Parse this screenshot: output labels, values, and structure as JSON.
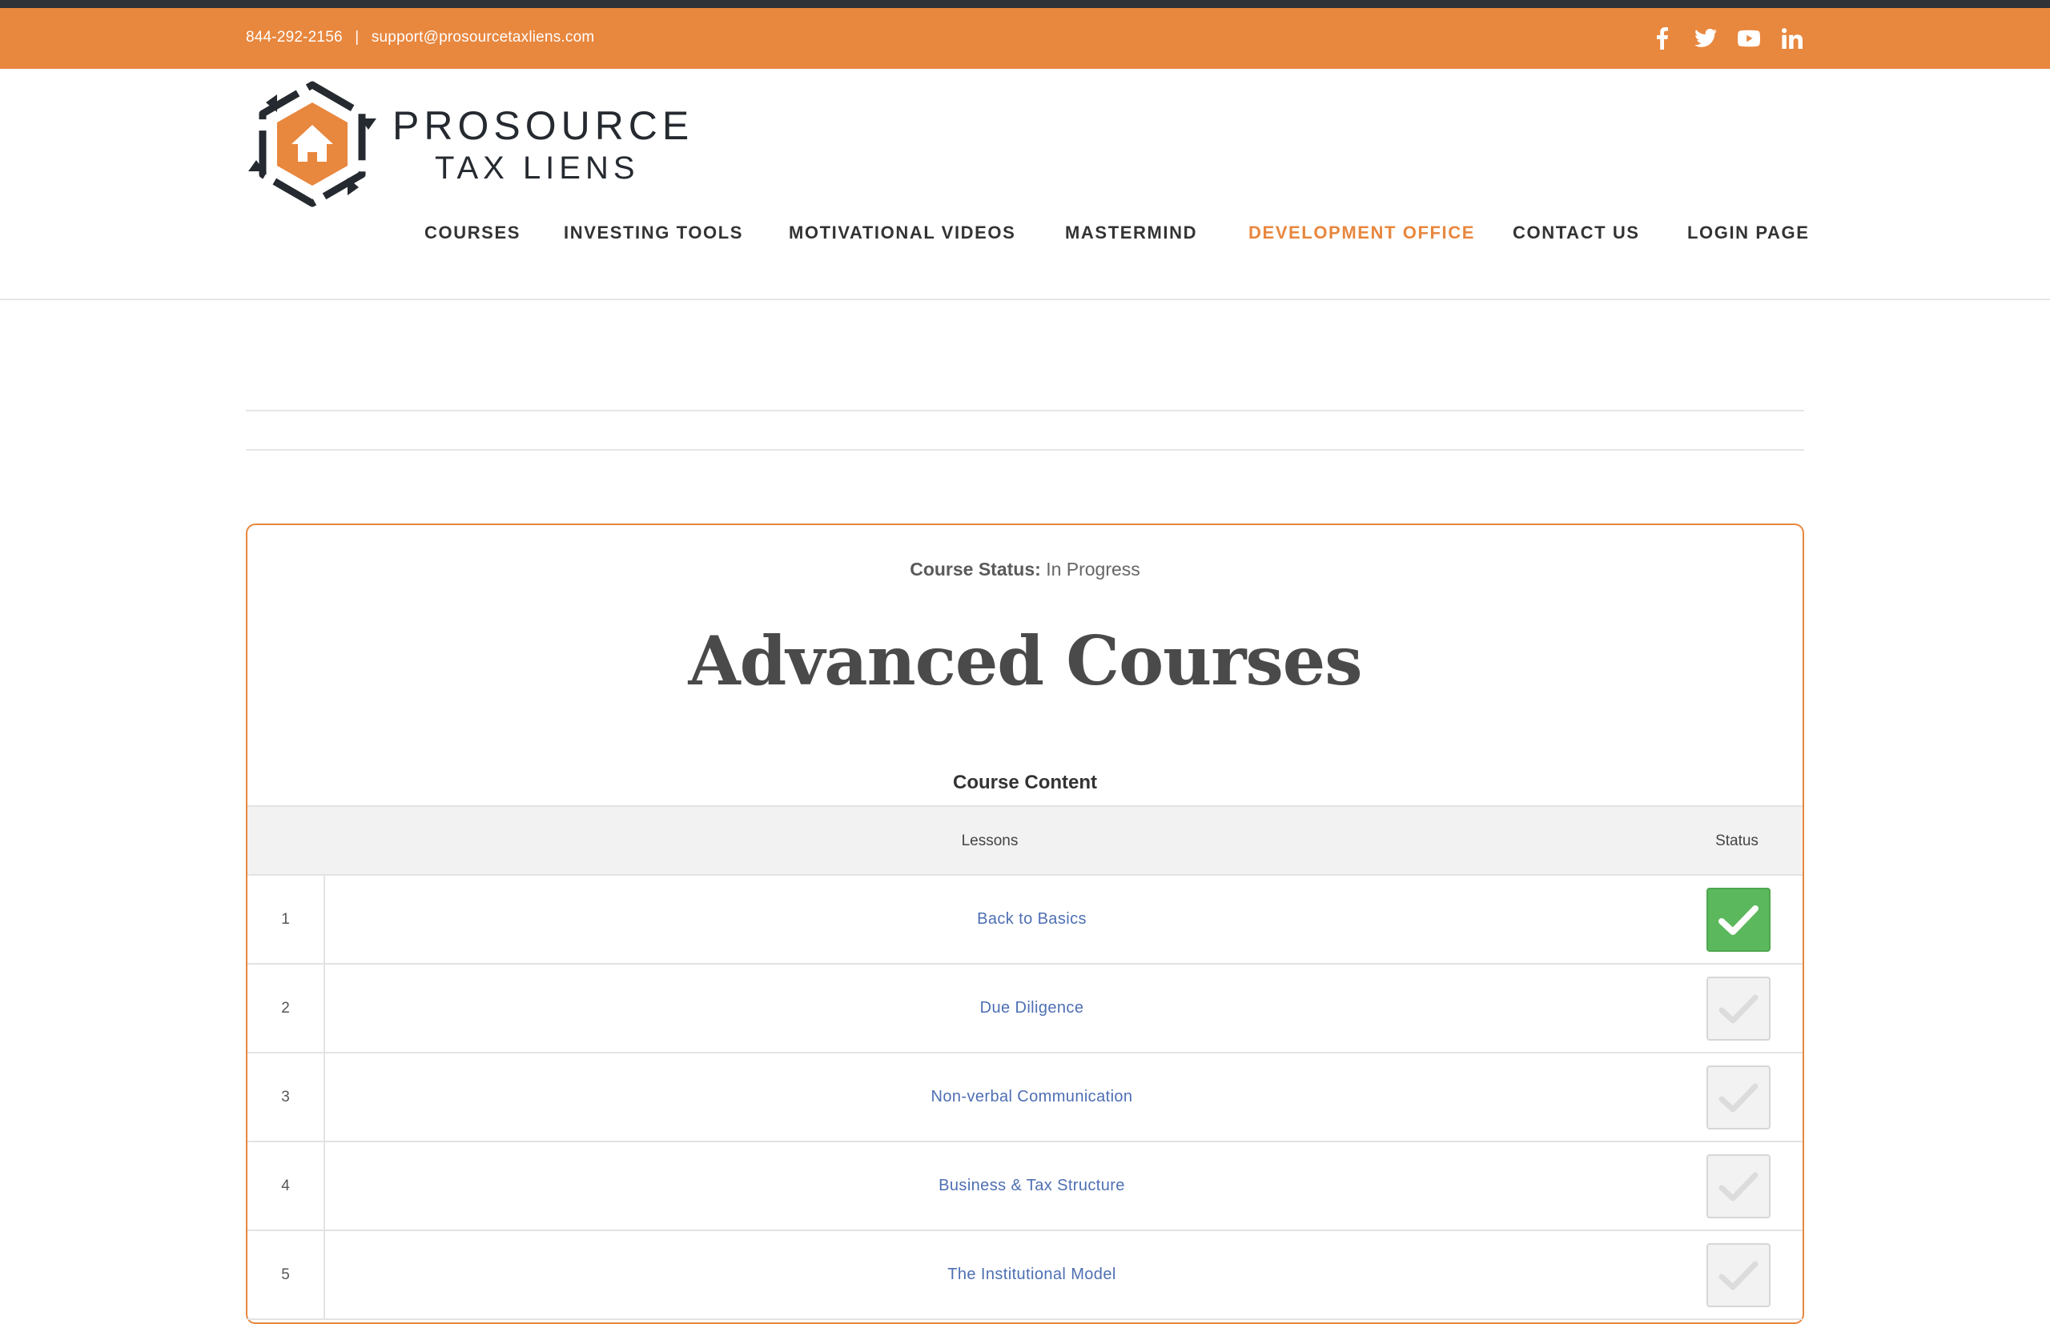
{
  "topbar": {
    "phone": "844-292-2156",
    "separator": "|",
    "email": "support@prosourcetaxliens.com",
    "social": [
      "facebook-icon",
      "twitter-icon",
      "youtube-icon",
      "linkedin-icon"
    ],
    "color": "#e8873e"
  },
  "brand": {
    "line1": "PROSOURCE",
    "line2": "TAX LIENS",
    "accent": "#e8873e",
    "dark": "#252a30"
  },
  "nav": {
    "items": [
      {
        "label": "COURSES"
      },
      {
        "label": "INVESTING TOOLS"
      },
      {
        "label": "MOTIVATIONAL VIDEOS"
      },
      {
        "label": "MASTERMIND"
      },
      {
        "label": "DEVELOPMENT OFFICE"
      },
      {
        "label": "CONTACT US"
      },
      {
        "label": "LOGIN PAGE"
      }
    ],
    "active": "DEVELOPMENT OFFICE"
  },
  "course": {
    "status_label": "Course Status:",
    "status_value": "In Progress",
    "title": "Advanced Courses",
    "content_heading": "Course Content",
    "columns": {
      "lessons": "Lessons",
      "status": "Status"
    },
    "lessons": [
      {
        "num": "1",
        "title": "Back to Basics",
        "completed": true
      },
      {
        "num": "2",
        "title": "Due Diligence",
        "completed": false
      },
      {
        "num": "3",
        "title": "Non-verbal Communication",
        "completed": false
      },
      {
        "num": "4",
        "title": "Business & Tax Structure",
        "completed": false
      },
      {
        "num": "5",
        "title": "The Institutional Model",
        "completed": false
      }
    ],
    "complete_color": "#5cb85c"
  }
}
